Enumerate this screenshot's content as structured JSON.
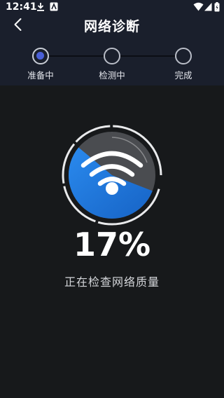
{
  "status_bar": {
    "time": "12:41",
    "icons": [
      "download-icon",
      "app-notification-icon",
      "wifi-icon",
      "signal-icon",
      "battery-icon"
    ]
  },
  "header": {
    "title": "网络诊断",
    "back_icon": "chevron-left-icon"
  },
  "steps": [
    {
      "label": "准备中",
      "state": "active"
    },
    {
      "label": "检测中",
      "state": "pending"
    },
    {
      "label": "完成",
      "state": "pending"
    }
  ],
  "progress": {
    "value": 17,
    "text": "17%",
    "status": "正在检查网络质量"
  },
  "colors": {
    "header_bg": "#1a1f2c",
    "body_bg": "#17191b",
    "accent_blue": "#1d7fe3",
    "step_active": "#4a5fd6"
  }
}
